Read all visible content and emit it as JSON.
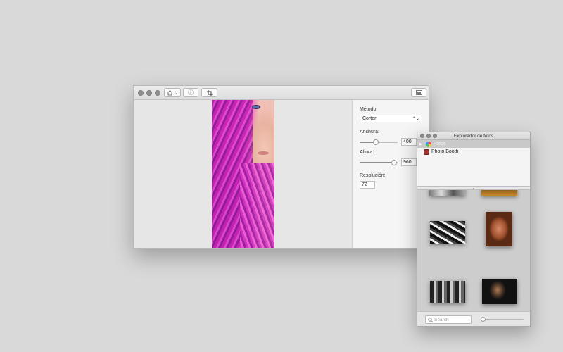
{
  "preview_window": {
    "toolbar": {
      "share_icon": "share-icon",
      "share_chevron": "⌄",
      "info_icon": "ⓘ",
      "crop_icon": "crop-icon",
      "sidebar_icon": "sidebar-icon"
    },
    "sidebar": {
      "method_label": "Método:",
      "method_value": "Cortar",
      "width_label": "Anchura:",
      "width_value": "400",
      "width_level": 0.42,
      "height_label": "Altura:",
      "height_value": "960",
      "height_level": 0.98,
      "resolution_label": "Resolución:",
      "resolution_value": "72"
    }
  },
  "photo_browser": {
    "title": "Explorador de fotos",
    "sources": [
      {
        "label": "Fotos",
        "selected": true
      },
      {
        "label": "Photo Booth",
        "selected": false
      }
    ],
    "search_placeholder": "Search",
    "zoom_level": 0.0
  }
}
